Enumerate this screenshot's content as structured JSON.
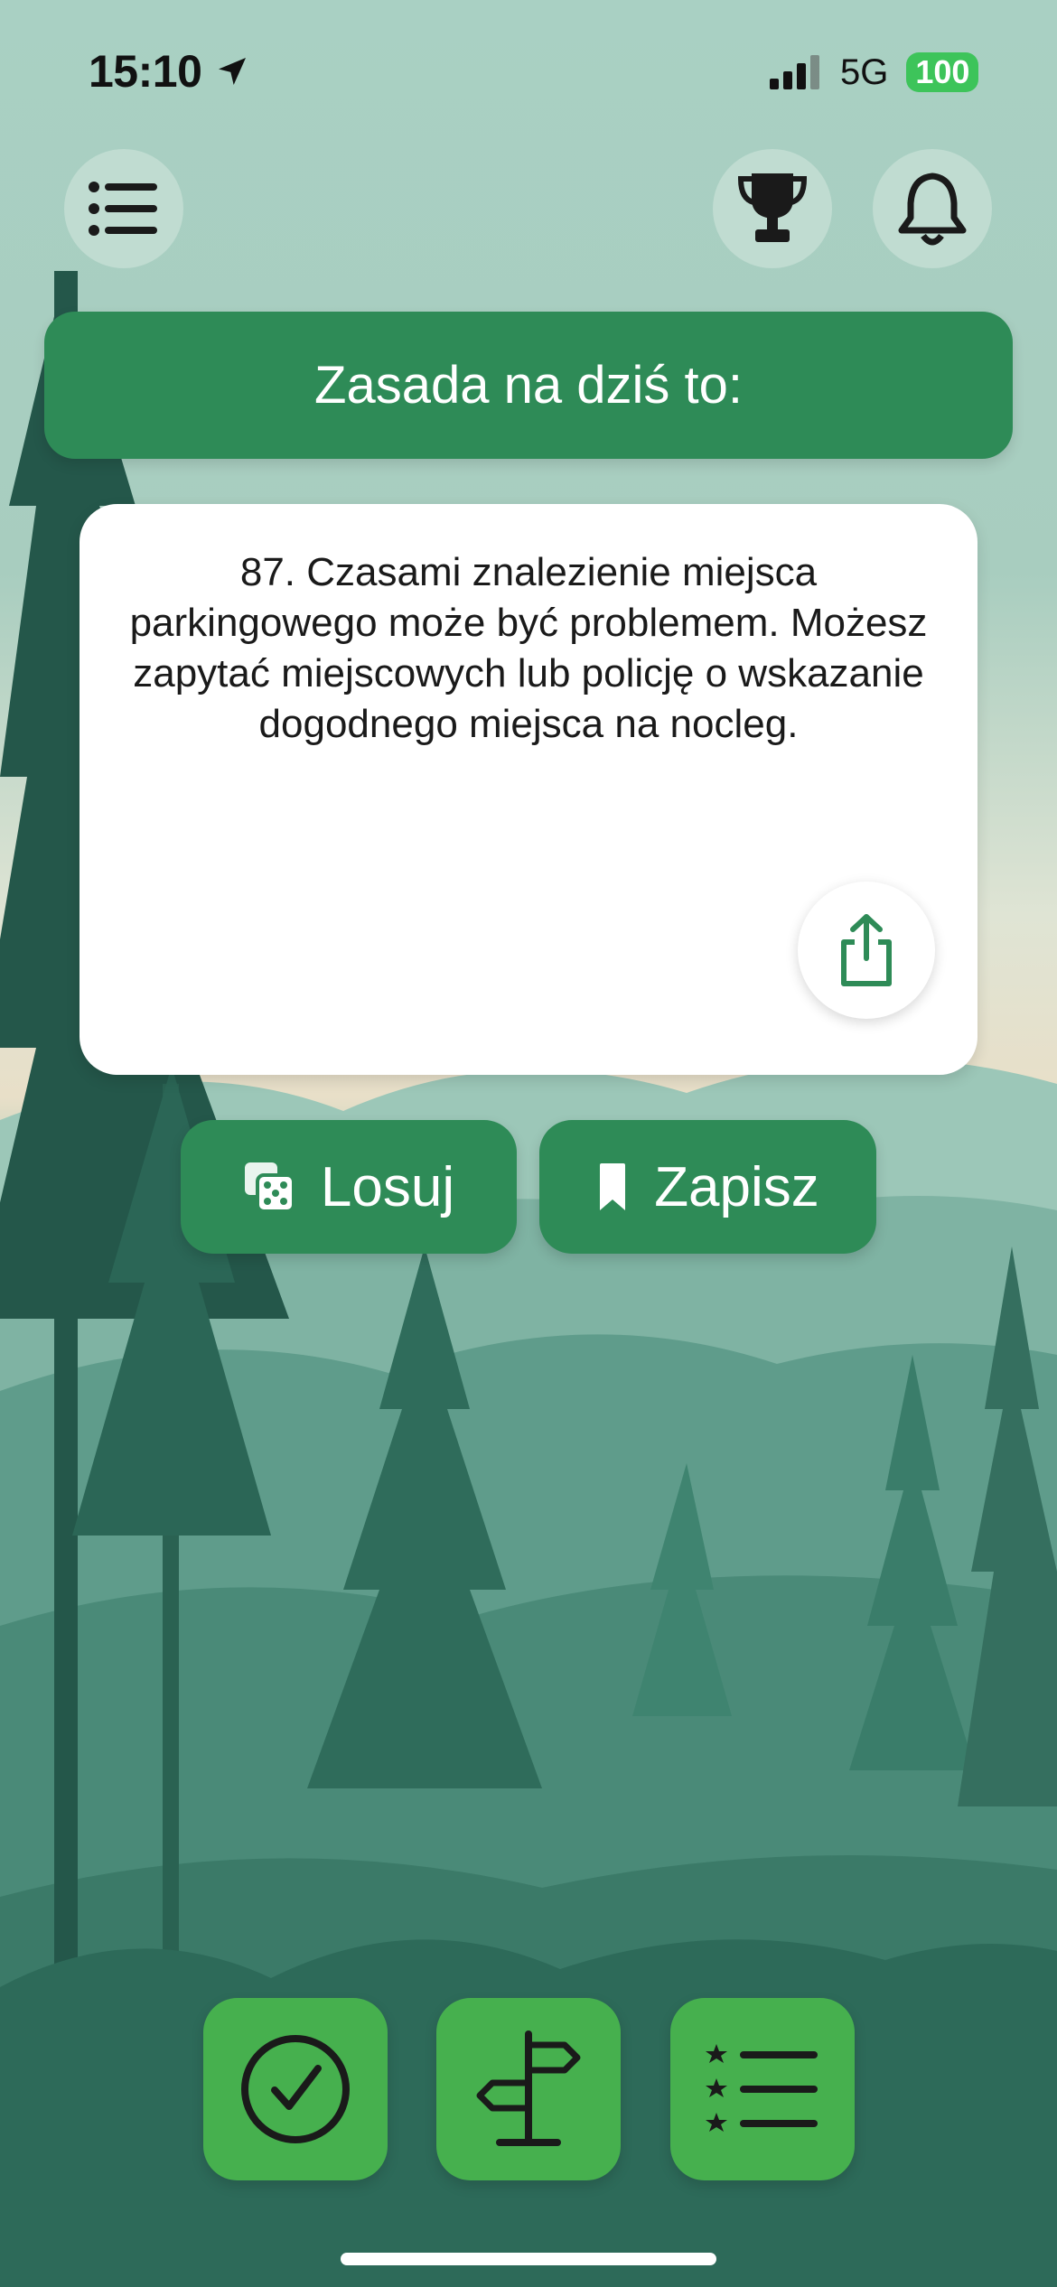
{
  "status_bar": {
    "time": "15:10",
    "network": "5G",
    "battery": "100"
  },
  "banner": {
    "title": "Zasada na dziś to:"
  },
  "rule_card": {
    "text": "87. Czasami znalezienie miejsca parkingowego może być problemem. Możesz zapytać miejscowych lub policję o wskazanie dogodnego miejsca na nocleg."
  },
  "actions": {
    "random_label": "Losuj",
    "save_label": "Zapisz"
  },
  "icons": {
    "menu": "menu-icon",
    "trophy": "trophy-icon",
    "bell": "bell-icon",
    "share": "share-icon",
    "dice": "dice-icon",
    "bookmark": "bookmark-icon",
    "check": "check-circle-icon",
    "signpost": "signpost-icon",
    "ranked_list": "ranked-list-icon"
  },
  "colors": {
    "primary_green": "#2e8b57",
    "tile_green": "#46b04e",
    "battery_green": "#3dc45a"
  }
}
